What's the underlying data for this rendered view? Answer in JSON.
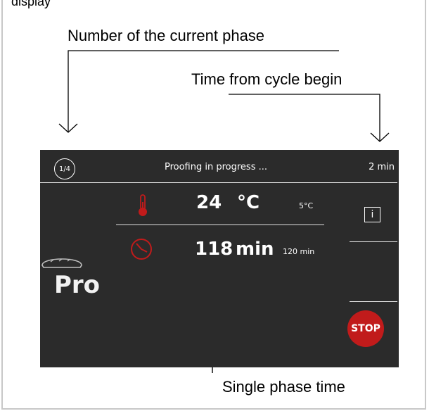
{
  "top_fragment": "display",
  "callouts": {
    "phase_number": "Number of the current phase",
    "cycle_time": "Time from cycle begin",
    "single_phase_time": "Single phase time"
  },
  "screen": {
    "phase_badge": "1/4",
    "status": "Proofing in progress ...",
    "elapsed": "2 min",
    "temperature": {
      "value": "24",
      "unit": "°C",
      "setpoint": "5°C"
    },
    "time": {
      "value": "118",
      "unit": "min",
      "setpoint": "120 min"
    },
    "program_label": "Pro",
    "info_label": "i",
    "stop_label": "STOP"
  },
  "colors": {
    "screen_bg": "#2b2b2b",
    "accent_red": "#c11b1b",
    "text": "#ffffff"
  },
  "icons": [
    "thermometer-icon",
    "clock-icon",
    "bread-icon",
    "info-icon"
  ]
}
